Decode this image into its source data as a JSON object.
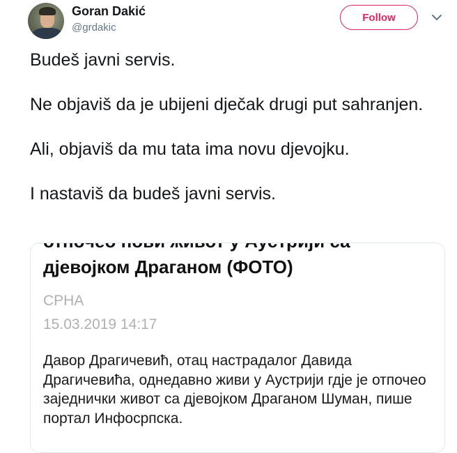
{
  "user": {
    "display_name": "Goran Dakić",
    "handle": "@grdakic",
    "avatar_icon": "user-avatar"
  },
  "follow_button": {
    "label": "Follow",
    "color": "#e0245e"
  },
  "menu_icon": "chevron-down-icon",
  "tweet": {
    "lines": [
      "Budeš javni servis.",
      "Ne objaviš da je ubijeni dječak drugi put sahranjen.",
      "Ali, objaviš da mu tata ima novu djevojku.",
      "I nastaviš da budeš javni servis."
    ]
  },
  "card": {
    "title_cut": "отпочео нови живот у Аустрији са",
    "title": "дјевојком Драганом (ФОТО)",
    "source": "СРНА",
    "date": "15.03.2019 14:17",
    "body": "Давор Драгичевић, отац настрадалог Давида Драгичевића, однедавно живи у Аустрији гдје је отпочео заједнички живот са дјевојком Драганом Шуман, пише портал Инфосрпска."
  }
}
